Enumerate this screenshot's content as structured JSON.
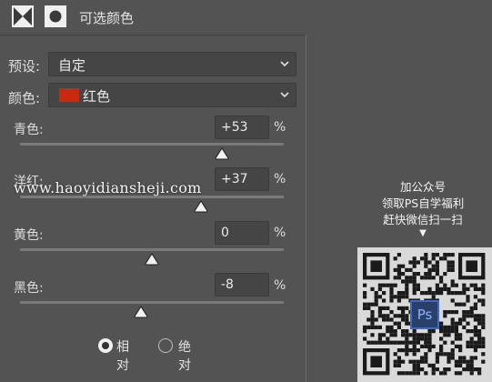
{
  "header": {
    "title": "可选颜色",
    "adjustment_icon": "selective-color-adjustment-icon",
    "mask_icon": "layer-mask-icon"
  },
  "preset": {
    "label": "预设:",
    "value": "自定"
  },
  "colors": {
    "label": "颜色:",
    "value": "红色",
    "swatch_color": "#c92a0f"
  },
  "sliders": [
    {
      "label": "青色:",
      "value": "+53",
      "unit": "%",
      "percent": 53
    },
    {
      "label": "洋红:",
      "value": "+37",
      "unit": "%",
      "percent": 37
    },
    {
      "label": "黄色:",
      "value": "0",
      "unit": "%",
      "percent": 0
    },
    {
      "label": "黑色:",
      "value": "-8",
      "unit": "%",
      "percent": -8
    }
  ],
  "method": {
    "options": [
      {
        "label": "相对",
        "selected": true
      },
      {
        "label": "绝对",
        "selected": false
      }
    ]
  },
  "watermark": "www.haoyidiansheji.com",
  "promo": {
    "lines": [
      "加公众号",
      "领取PS自学福利",
      "赶快微信扫一扫"
    ],
    "arrow": "▼",
    "logo_text": "Ps"
  }
}
